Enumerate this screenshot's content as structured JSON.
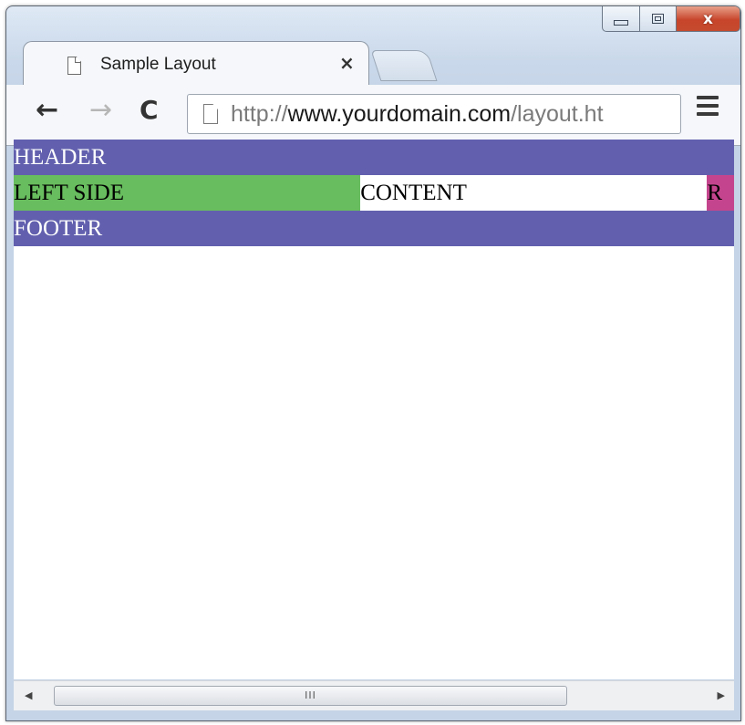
{
  "window": {
    "controls": {
      "minimize_icon": "minimize-icon",
      "maximize_icon": "maximize-icon",
      "close_label": "x"
    }
  },
  "tabs": [
    {
      "title": "Sample Layout",
      "close_label": "×"
    }
  ],
  "toolbar": {
    "back_label": "←",
    "forward_label": "→",
    "reload_label": "C",
    "menu_icon": "hamburger-menu-icon"
  },
  "address_bar": {
    "scheme": "http://",
    "host": "www.yourdomain.com",
    "path": "/layout.ht"
  },
  "page": {
    "header": "HEADER",
    "left_side": "LEFT SIDE",
    "content": "CONTENT",
    "right_side": "R",
    "footer": "FOOTER"
  },
  "scrollbar": {
    "left_arrow": "◀",
    "thumb_grip": "III",
    "right_arrow": "▶"
  },
  "colors": {
    "header_footer": "#6260ae",
    "left_side": "#68bd5e",
    "right_side": "#c4458d"
  }
}
